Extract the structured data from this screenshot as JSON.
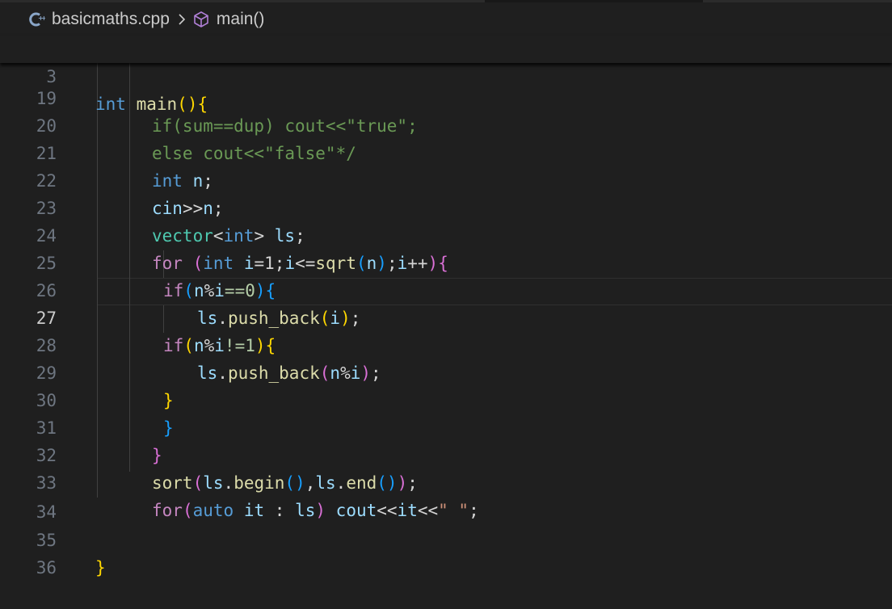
{
  "breadcrumb": {
    "file_icon": "cpp-file-icon",
    "file_name": "basicmaths.cpp",
    "separator_icon": "chevron-right-icon",
    "symbol_icon": "method-cube-icon",
    "symbol_name": "main()"
  },
  "sticky_line": {
    "number": "3",
    "text": "int main(){"
  },
  "lines": {
    "l19": {
      "n": "19"
    },
    "l20": {
      "n": "20"
    },
    "l21": {
      "n": "21"
    },
    "l22": {
      "n": "22"
    },
    "l23": {
      "n": "23"
    },
    "l24": {
      "n": "24"
    },
    "l25": {
      "n": "25"
    },
    "l26": {
      "n": "26"
    },
    "l27": {
      "n": "27"
    },
    "l28": {
      "n": "28"
    },
    "l29": {
      "n": "29"
    },
    "l30": {
      "n": "30"
    },
    "l31": {
      "n": "31"
    },
    "l32": {
      "n": "32"
    },
    "l33": {
      "n": "33"
    },
    "l34": {
      "n": "34"
    },
    "l35": {
      "n": "35"
    },
    "l36": {
      "n": "36"
    }
  },
  "tokens": {
    "t19": "if(sum==dup) cout<<\"true\";",
    "t20": "else cout<<\"false\"*/",
    "int": "int",
    "main": "main",
    "p_open": "(",
    "p_close": ")",
    "brace_open": "{",
    "brace_close": "}",
    "n": "n",
    "semi": ";",
    "cin": "cin",
    "shr": ">>",
    "vector": "vector",
    "lt": "<",
    "gt": ">",
    "ls": "ls",
    "for": "for",
    "i": "i",
    "eq1": "=1;",
    "le": "<=",
    "sqrt": "sqrt",
    "inc": "++",
    "if": "if",
    "mod": "%",
    "eqeq0": "==0",
    "neq1": "!=1",
    "dot": ".",
    "push_back": "push_back",
    "sort": "sort",
    "begin": "begin",
    "comma": ",",
    "end": "end",
    "auto": "auto",
    "it": "it",
    "colon": " : ",
    "cout": "cout",
    "shl": "<<",
    "space_str": "\" \"",
    "space": " "
  },
  "current_line": "27"
}
